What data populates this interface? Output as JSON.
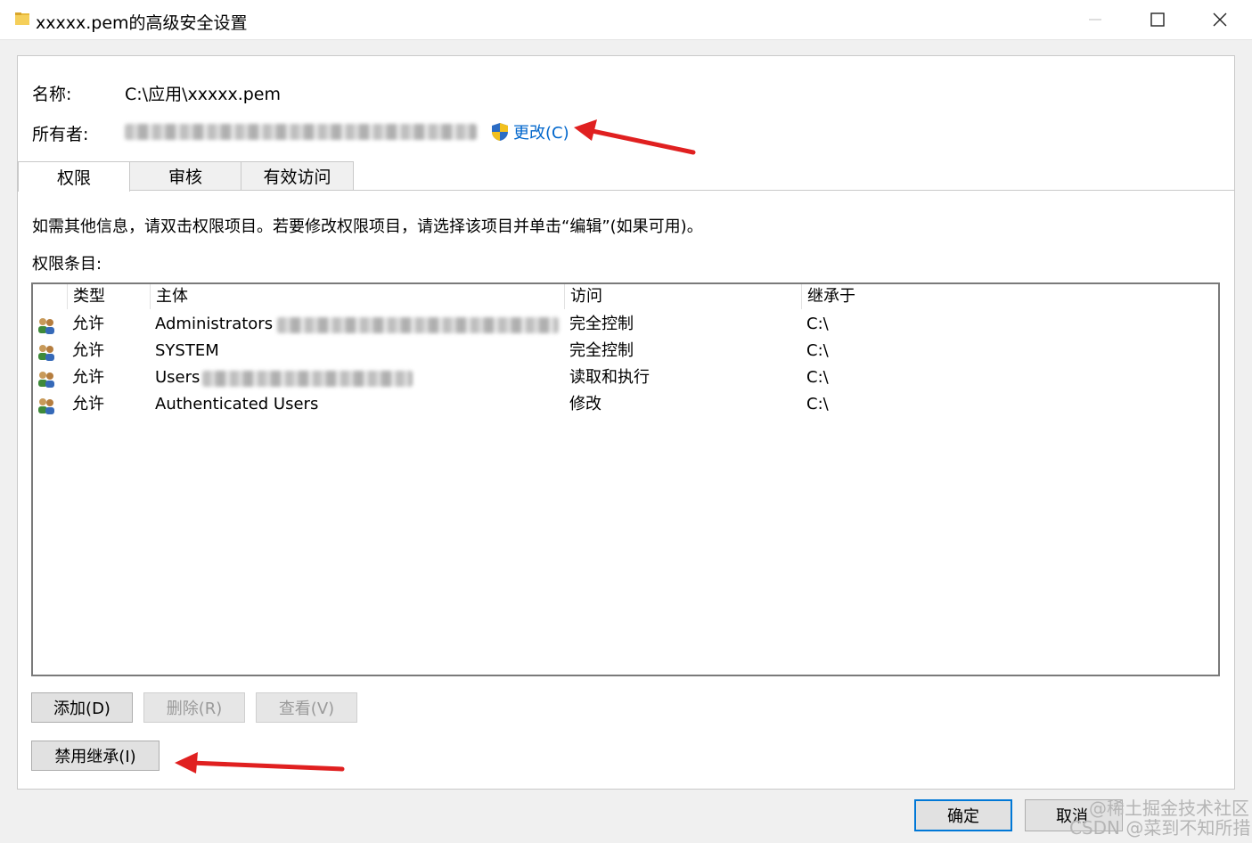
{
  "window": {
    "title": "xxxxx.pem的高级安全设置",
    "minimize_icon": "minimize-icon",
    "maximize_icon": "maximize-icon",
    "close_icon": "close-icon"
  },
  "info": {
    "name_label": "名称:",
    "name_value": "C:\\应用\\xxxxx.pem",
    "owner_label": "所有者:",
    "change_label": "更改(C)",
    "shield_icon": "uac-shield-icon"
  },
  "tabs": [
    {
      "label": "权限",
      "active": true
    },
    {
      "label": "审核",
      "active": false
    },
    {
      "label": "有效访问",
      "active": false
    }
  ],
  "description": "如需其他信息，请双击权限项目。若要修改权限项目，请选择该项目并单击“编辑”(如果可用)。",
  "entries_label": "权限条目:",
  "table": {
    "headers": [
      "类型",
      "主体",
      "访问",
      "继承于"
    ],
    "rows": [
      {
        "type": "允许",
        "principal": "Administrators",
        "access": "完全控制",
        "inherited": "C:\\"
      },
      {
        "type": "允许",
        "principal": "SYSTEM",
        "access": "完全控制",
        "inherited": "C:\\"
      },
      {
        "type": "允许",
        "principal": "Users",
        "access": "读取和执行",
        "inherited": "C:\\"
      },
      {
        "type": "允许",
        "principal": "Authenticated Users",
        "access": "修改",
        "inherited": "C:\\"
      }
    ]
  },
  "buttons": {
    "add": "添加(D)",
    "remove": "删除(R)",
    "view": "查看(V)",
    "disable_inheritance": "禁用继承(I)",
    "ok": "确定",
    "cancel": "取消"
  },
  "watermark": {
    "line1": "@稀土掘金技术社区",
    "line2": "CSDN @菜到不知所措"
  },
  "colors": {
    "link": "#0066cc",
    "arrow": "#e02020",
    "default_button_border": "#0078d7"
  }
}
